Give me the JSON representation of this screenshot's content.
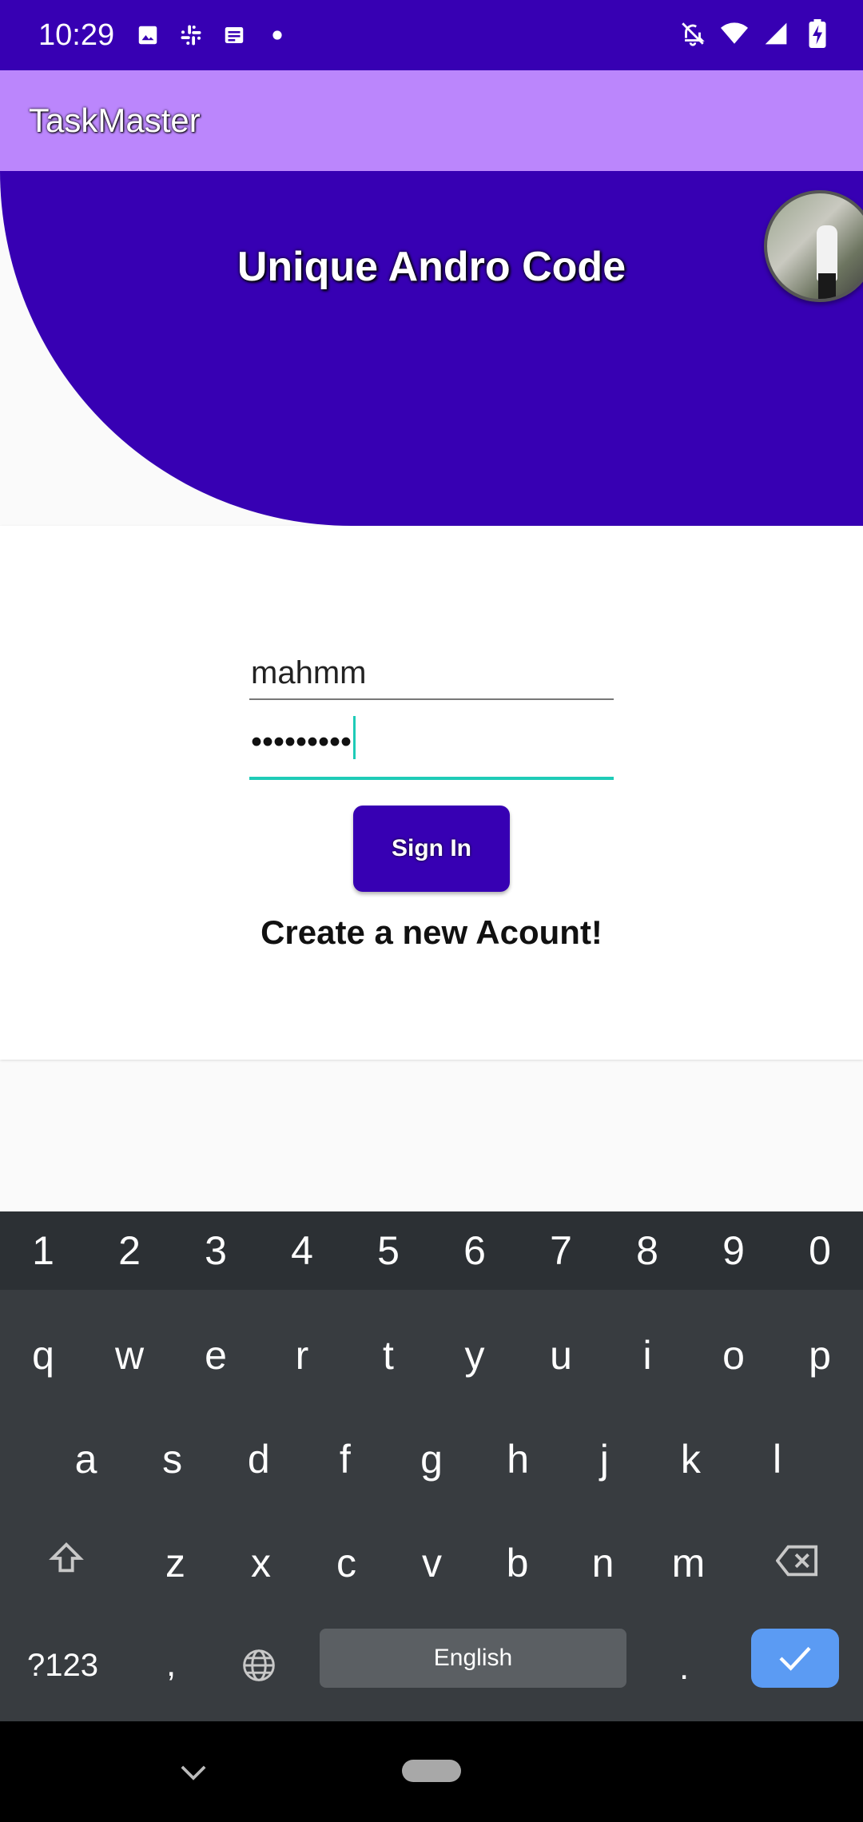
{
  "status_bar": {
    "time": "10:29"
  },
  "app_bar": {
    "title": "TaskMaster"
  },
  "header": {
    "title": "Unique Andro Code"
  },
  "login": {
    "username_value": "mahmm",
    "password_dots": "•••••••••",
    "signin_label": "Sign In",
    "create_account_label": "Create a new Acount!"
  },
  "keyboard": {
    "numbers": [
      "1",
      "2",
      "3",
      "4",
      "5",
      "6",
      "7",
      "8",
      "9",
      "0"
    ],
    "row1": [
      "q",
      "w",
      "e",
      "r",
      "t",
      "y",
      "u",
      "i",
      "o",
      "p"
    ],
    "row2": [
      "a",
      "s",
      "d",
      "f",
      "g",
      "h",
      "j",
      "k",
      "l"
    ],
    "row3": [
      "z",
      "x",
      "c",
      "v",
      "b",
      "n",
      "m"
    ],
    "symbols_label": "?123",
    "comma_label": ",",
    "space_label": "English",
    "period_label": "."
  },
  "colors": {
    "primary": "#3700b3",
    "app_bar": "#bb86fc",
    "accent": "#1ecbb7",
    "keyboard_bg": "#383c40",
    "enter_key": "#5b9bf3"
  }
}
